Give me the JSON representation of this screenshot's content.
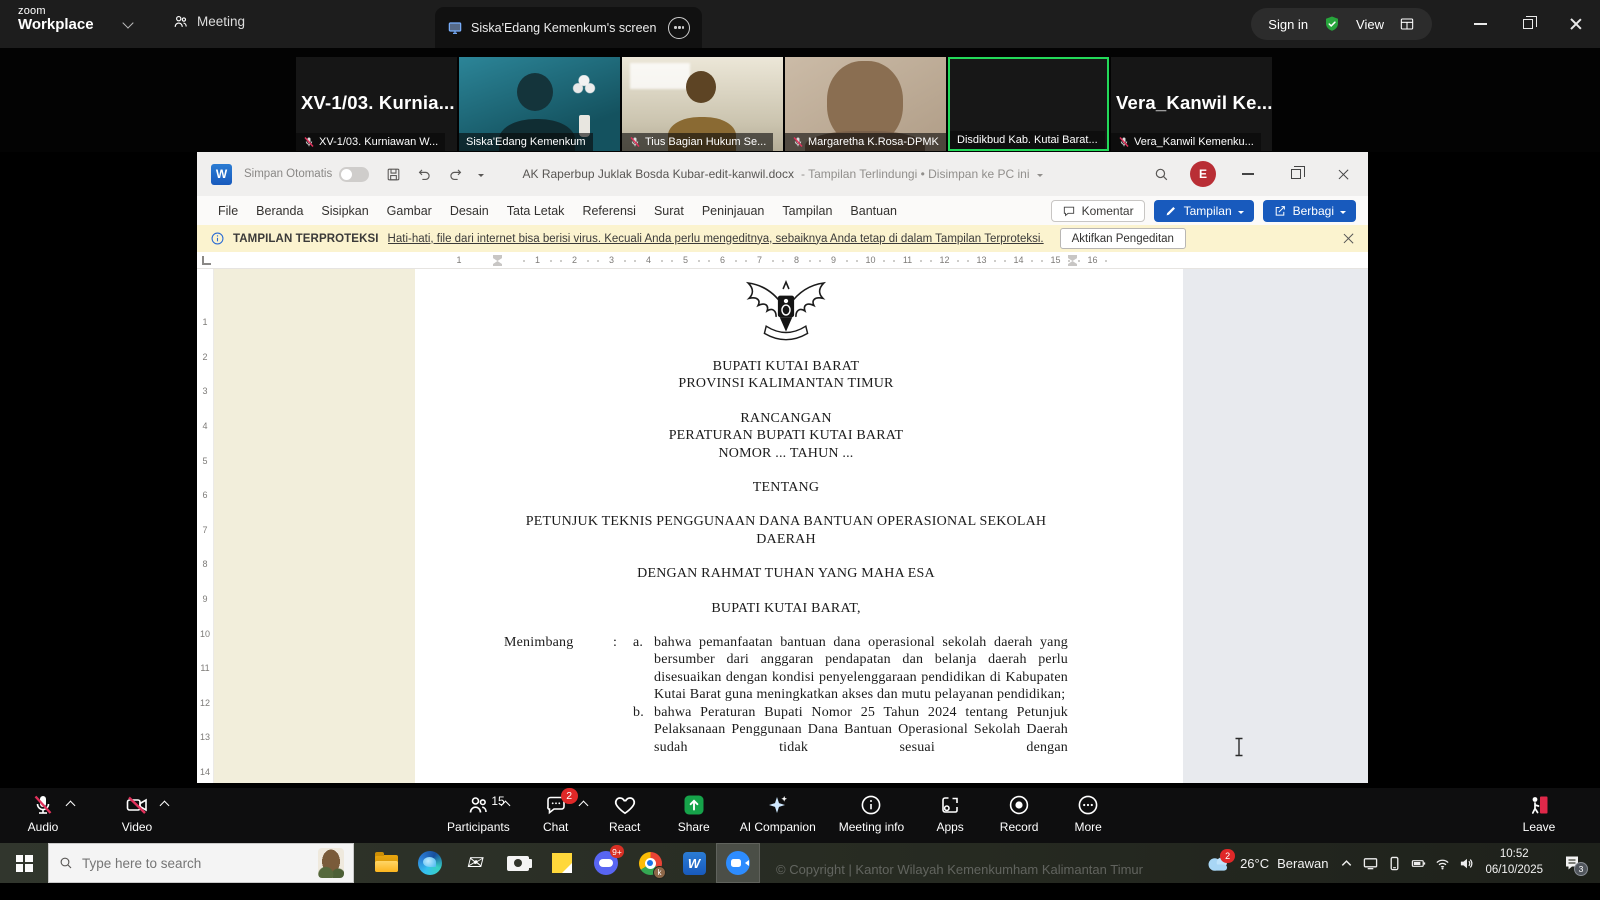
{
  "top_bar": {
    "logo_top": "zoom",
    "logo_bottom": "Workplace",
    "meeting_tab": "Meeting",
    "screen_tab": "Siska'Edang Kemenkum's screen",
    "sign_in": "Sign in",
    "view_label": "View"
  },
  "video_strip": {
    "participants": [
      {
        "label": "XV-1/03. Kurniawan W...",
        "big_text": "XV-1/03.  Kurnia...",
        "muted": true,
        "kind": "text"
      },
      {
        "label": "Siska'Edang Kemenkum",
        "kind": "photo-teal"
      },
      {
        "label": "Tius Bagian Hukum Se...",
        "muted": true,
        "kind": "photo-room"
      },
      {
        "label": "Margaretha K.Rosa-DPMK",
        "muted": true,
        "kind": "photo-face"
      },
      {
        "label": "Disdikbud Kab. Kutai Barat...",
        "kind": "active-dark"
      },
      {
        "label": "Vera_Kanwil Kemenku...",
        "big_text": "Vera_Kanwil  Ke...",
        "muted": true,
        "kind": "text"
      }
    ]
  },
  "word": {
    "titlebar": {
      "app_initial": "W",
      "autosave": "Simpan Otomatis",
      "doc_title": "AK Raperbup Juklak Bosda Kubar-edit-kanwil.docx",
      "title_suffix": "-  Tampilan Terlindungi  •  Disimpan ke PC ini",
      "avatar": "E"
    },
    "menu_tabs": [
      "File",
      "Beranda",
      "Sisipkan",
      "Gambar",
      "Desain",
      "Tata Letak",
      "Referensi",
      "Surat",
      "Peninjauan",
      "Tampilan",
      "Bantuan"
    ],
    "actions": {
      "comment": "Komentar",
      "view": "Tampilan",
      "share": "Berbagi"
    },
    "banner": {
      "title": "TAMPILAN TERPROTEKSI",
      "message": "Hati-hati, file dari internet bisa berisi virus. Kecuali Anda perlu mengeditnya, sebaiknya Anda tetap di dalam Tampilan Terproteksi.",
      "action": "Aktifkan Pengeditan"
    },
    "ruler": {
      "h_margin": "1",
      "h": [
        "1",
        "2",
        "3",
        "4",
        "5",
        "6",
        "7",
        "8",
        "9",
        "10",
        "11",
        "12",
        "13",
        "14",
        "15",
        "16"
      ],
      "v": [
        "1",
        "2",
        "3",
        "4",
        "5",
        "6",
        "7",
        "8",
        "9",
        "10",
        "11",
        "12",
        "13",
        "14"
      ]
    },
    "document": {
      "heading1": "BUPATI KUTAI BARAT",
      "heading2": "PROVINSI KALIMANTAN TIMUR",
      "line_rancangan": "RANCANGAN",
      "line_peraturan": "PERATURAN BUPATI KUTAI BARAT",
      "line_nomor": "NOMOR ... TAHUN ...",
      "tentang": "TENTANG",
      "subject": "PETUNJUK TEKNIS PENGGUNAAN DANA BANTUAN OPERASIONAL SEKOLAH DAERAH",
      "invocation": "DENGAN RAHMAT TUHAN YANG MAHA ESA",
      "salutation": "BUPATI KUTAI BARAT,",
      "menimbang_label": "Menimbang",
      "colon": ":",
      "considerations": [
        {
          "marker": "a.",
          "text": "bahwa pemanfaatan bantuan dana  operasional sekolah daerah yang bersumber dari anggaran pendapatan dan belanja daerah perlu disesuaikan dengan kondisi penyelenggaraan pendidikan di Kabupaten Kutai Barat guna meningkatkan akses dan mutu pelayanan pendidikan;"
        },
        {
          "marker": "b.",
          "text": "bahwa Peraturan Bupati Nomor 25 Tahun 2024 tentang Petunjuk Pelaksanaan Penggunaan Dana Bantuan Operasional Sekolah Daerah sudah tidak sesuai dengan",
          "clipped": true
        }
      ]
    }
  },
  "zoom_toolbar": {
    "left": [
      {
        "label": "Audio",
        "icon": "#i-mic",
        "chevron": true
      },
      {
        "label": "Video",
        "icon": "#i-cam",
        "chevron": true
      }
    ],
    "center": [
      {
        "label": "Participants",
        "icon": "#i-people",
        "count": "15",
        "chevron": true
      },
      {
        "label": "Chat",
        "icon": "#i-chat",
        "badge": "2",
        "chevron": true
      },
      {
        "label": "React",
        "icon": "#i-heart"
      },
      {
        "label": "Share",
        "icon": "#i-share",
        "kind": "share"
      },
      {
        "label": "AI Companion",
        "icon": "#i-ai"
      },
      {
        "label": "Meeting info",
        "icon": "#i-info"
      },
      {
        "label": "Apps",
        "icon": "#i-apps"
      },
      {
        "label": "Record",
        "icon": "#i-record"
      },
      {
        "label": "More",
        "icon": "#i-more"
      }
    ],
    "leave": {
      "label": "Leave",
      "icon": "#i-leave"
    }
  },
  "taskbar": {
    "search_placeholder": "Type here to search",
    "apps": [
      {
        "kind": "explorer",
        "name": "file-explorer"
      },
      {
        "kind": "edge",
        "name": "edge-browser"
      },
      {
        "kind": "mail",
        "name": "mail",
        "glyph": "✉"
      },
      {
        "kind": "camera",
        "name": "camera"
      },
      {
        "kind": "notes",
        "name": "sticky-notes"
      },
      {
        "kind": "discord",
        "name": "discord",
        "badge": "9+"
      },
      {
        "kind": "chrome",
        "name": "chrome-browser",
        "overlay": "k"
      },
      {
        "kind": "word",
        "name": "word",
        "glyph": "W"
      },
      {
        "kind": "zoom",
        "name": "zoom",
        "active": true
      }
    ],
    "weather_temp": "26°C",
    "weather_text": "Berawan",
    "weather_badge": "2",
    "time": "10:52",
    "date": "06/10/2025",
    "notif_badge": "3",
    "watermark": "© Copyright | Kantor Wilayah Kemenkumham Kalimantan Timur"
  },
  "colors": {
    "word_blue": "#185abd",
    "zoom_blue": "#2d8cff",
    "active_speaker_green": "#23d959",
    "banner_yellow": "#fbf3cf",
    "mute_red": "#e0315b",
    "leave_red": "#e02849"
  }
}
